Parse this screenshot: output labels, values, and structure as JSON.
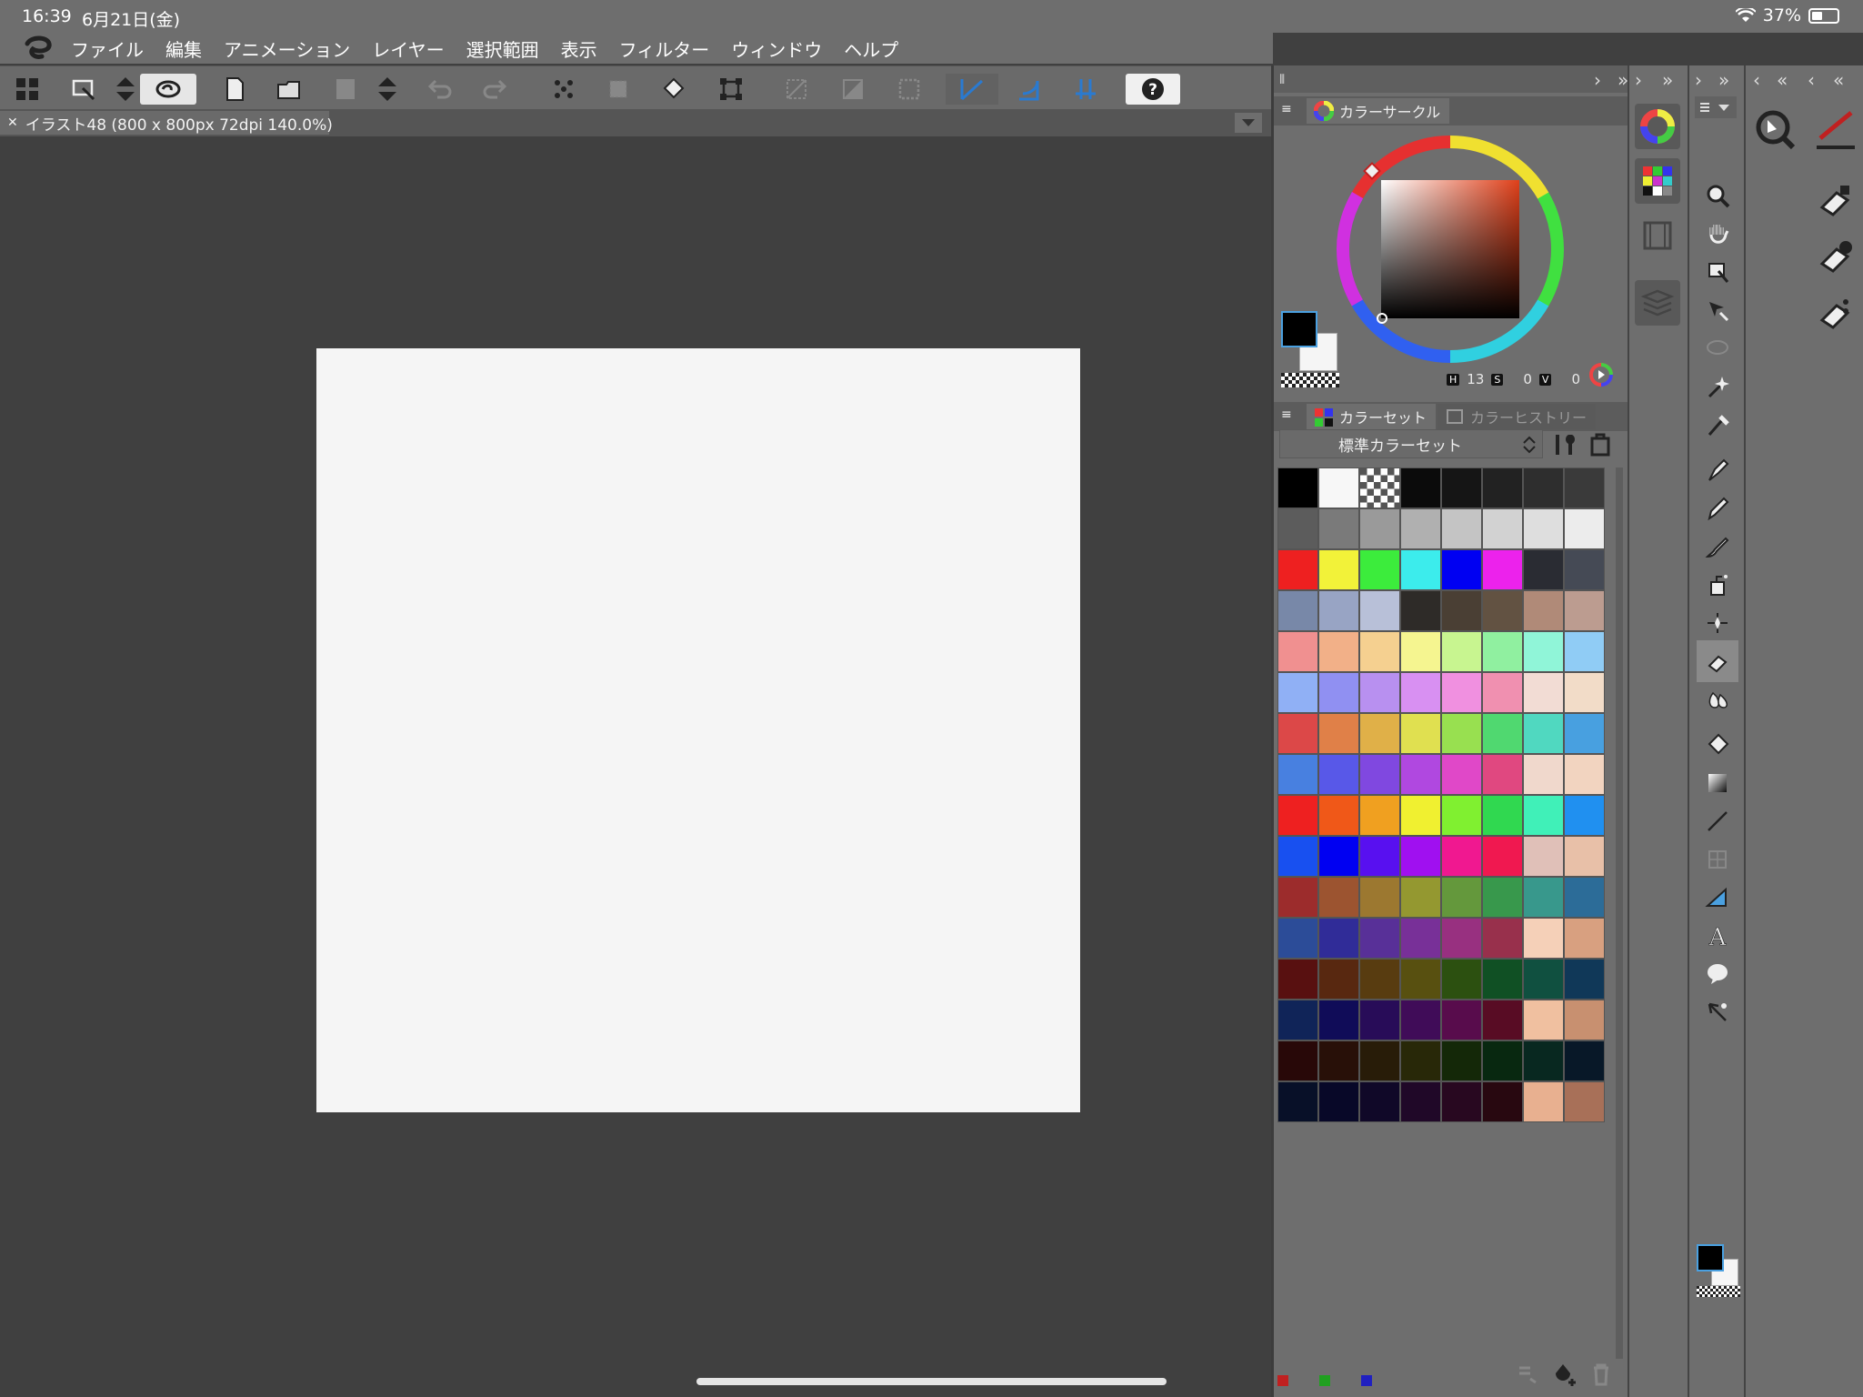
{
  "status": {
    "time": "16:39",
    "date": "6月21日(金)",
    "battery": "37%"
  },
  "menu": [
    "ファイル",
    "編集",
    "アニメーション",
    "レイヤー",
    "選択範囲",
    "表示",
    "フィルター",
    "ウィンドウ",
    "ヘルプ"
  ],
  "tab": {
    "title": "イラスト48 (800 x 800px 72dpi 140.0%)"
  },
  "color_circle": {
    "title": "カラーサークル",
    "h_label": "H",
    "h": "13",
    "s_label": "S",
    "s": "0",
    "v_label": "V",
    "v": "0"
  },
  "color_set": {
    "tab1": "カラーセット",
    "tab2": "カラーヒストリー",
    "set_name": "標準カラーセット"
  },
  "swatches": [
    "#000000",
    "#f7f7f7",
    "checker",
    "#0b0b0b",
    "#151515",
    "#222222",
    "#2e2e2e",
    "#3a3a3a",
    "#5c5c5c",
    "#7a7a7a",
    "#9a9a9a",
    "#b0b0b0",
    "#c4c4c4",
    "#d2d2d2",
    "#dedede",
    "#ececec",
    "#ee2020",
    "#f2f239",
    "#3cec3c",
    "#3cecec",
    "#0000f2",
    "#ec22ec",
    "#2a2c33",
    "#454a55",
    "#7888a8",
    "#98a4c4",
    "#b8c0d8",
    "#2e2b28",
    "#4a3f34",
    "#625242",
    "#b08a78",
    "#bc9c90",
    "#f09090",
    "#f2b088",
    "#f5d090",
    "#f5f590",
    "#c8f590",
    "#90f0a0",
    "#90f5d8",
    "#90ccf5",
    "#90b0f5",
    "#9090f2",
    "#b890f0",
    "#d890f2",
    "#f090e0",
    "#f090b0",
    "#f2dcd4",
    "#f2dcc8",
    "#dc4848",
    "#e08048",
    "#e0b048",
    "#e0e050",
    "#98e050",
    "#50d870",
    "#50d8c0",
    "#48a0e0",
    "#4880e0",
    "#5858e8",
    "#8048e0",
    "#b048e0",
    "#e048c8",
    "#e04880",
    "#f0d8cc",
    "#f2d4c0",
    "#ee2020",
    "#f05818",
    "#f0a020",
    "#f0f030",
    "#80f030",
    "#30d850",
    "#40f0b8",
    "#2090f0",
    "#1850f0",
    "#0000f2",
    "#5810f0",
    "#a010f0",
    "#f01890",
    "#f01850",
    "#e0c0b8",
    "#e8c0a8",
    "#9c2c2c",
    "#9c5430",
    "#9c7830",
    "#949830",
    "#64983c",
    "#38984c",
    "#38988c",
    "#2c6c98",
    "#2c4c98",
    "#302c98",
    "#583098",
    "#783098",
    "#983080",
    "#98304c",
    "#f5d0b8",
    "#d8a080",
    "#581010",
    "#582810",
    "#583c10",
    "#585010",
    "#2c5010",
    "#105024",
    "#105040",
    "#103858",
    "#102458",
    "#100c58",
    "#280c58",
    "#400c58",
    "#580c4c",
    "#580c24",
    "#f0c0a0",
    "#c89070",
    "#280808",
    "#281008",
    "#281c08",
    "#282808",
    "#142808",
    "#082810",
    "#082820",
    "#081828",
    "#081028",
    "#080828",
    "#100828",
    "#200828",
    "#280820",
    "#280810",
    "#e8b090",
    "#a87058"
  ],
  "sidebar_tools": [
    "zoom-icon",
    "hand-icon",
    "operation-icon",
    "move-layer-icon",
    "lasso-select-icon",
    "auto-select-icon",
    "eyedropper-icon",
    "pen-icon",
    "pencil-icon",
    "brush-icon",
    "airbrush-icon",
    "decoration-icon",
    "eraser-icon",
    "blend-icon",
    "fill-icon",
    "gradient-icon",
    "line-icon",
    "frame-border-icon",
    "ruler-icon",
    "text-icon",
    "balloon-icon",
    "correct-line-icon"
  ]
}
